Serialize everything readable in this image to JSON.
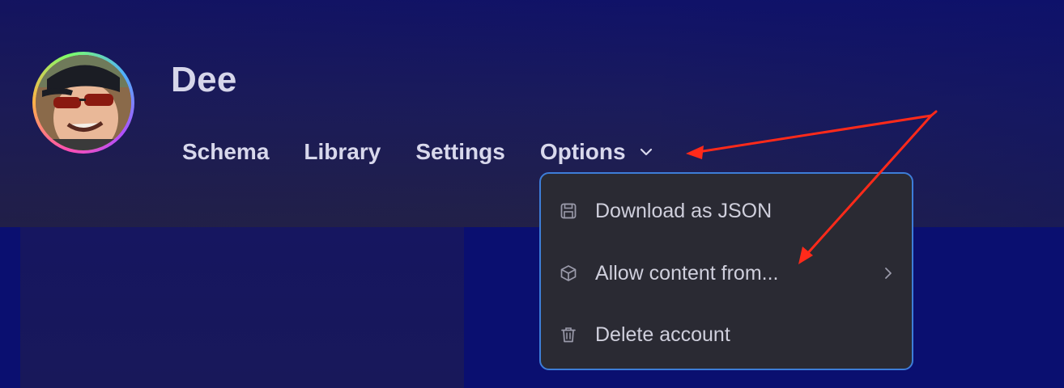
{
  "profile": {
    "name": "Dee",
    "avatar_icon": "user-photo"
  },
  "nav": {
    "items": [
      {
        "label": "Schema"
      },
      {
        "label": "Library"
      },
      {
        "label": "Settings"
      }
    ],
    "options_label": "Options",
    "options_icon": "chevron-down-icon"
  },
  "dropdown": {
    "items": [
      {
        "label": "Download as JSON",
        "icon": "save-icon"
      },
      {
        "label": "Allow content from...",
        "icon": "cube-icon",
        "has_submenu": true
      },
      {
        "label": "Delete account",
        "icon": "trash-icon"
      }
    ]
  },
  "colors": {
    "accent_border": "#3d7dd8",
    "annotation_arrow": "#ff2a1a",
    "background": "#0a0f70",
    "menu_background": "#2a2a33"
  }
}
